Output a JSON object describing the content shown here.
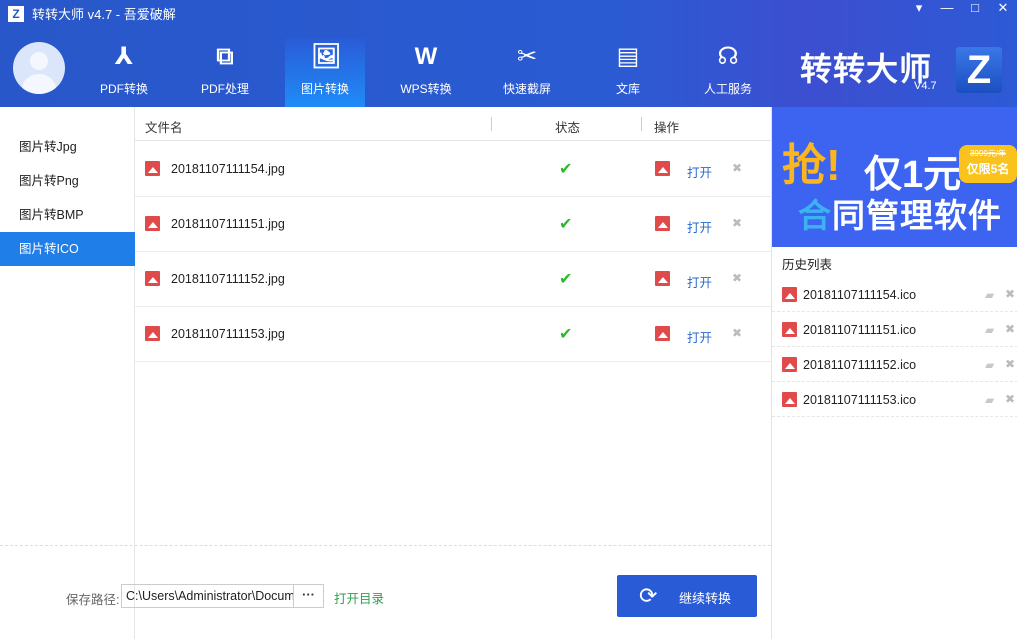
{
  "window": {
    "title": "转转大师 v4.7 - 吾爱破解",
    "app_icon": "Z",
    "controls": [
      "▾",
      "—",
      "□",
      "✕"
    ]
  },
  "nav": {
    "tabs": [
      {
        "label": "PDF转换",
        "icon": "pdf-icon",
        "glyph": "⅄"
      },
      {
        "label": "PDF处理",
        "icon": "squares-icon",
        "glyph": "⧉"
      },
      {
        "label": "图片转换",
        "icon": "image-icon",
        "glyph": "🖼"
      },
      {
        "label": "WPS转换",
        "icon": "wps-icon",
        "glyph": "W"
      },
      {
        "label": "快速截屏",
        "icon": "scissors-icon",
        "glyph": "✂"
      },
      {
        "label": "文库",
        "icon": "book-icon",
        "glyph": "▤"
      },
      {
        "label": "人工服务",
        "icon": "headset-icon",
        "glyph": "☊"
      }
    ],
    "active": 2
  },
  "brand": {
    "name": "转转大师",
    "version": "V4.7",
    "logo": "Z"
  },
  "sidebar": {
    "items": [
      "图片转Jpg",
      "图片转Png",
      "图片转BMP",
      "图片转ICO"
    ],
    "active": 3
  },
  "table": {
    "headers": {
      "name": "文件名",
      "status": "状态",
      "action": "操作"
    },
    "rows": [
      {
        "name": "20181107111154.jpg",
        "status": "✔",
        "open": "打开",
        "remove": "✖"
      },
      {
        "name": "20181107111151.jpg",
        "status": "✔",
        "open": "打开",
        "remove": "✖"
      },
      {
        "name": "20181107111152.jpg",
        "status": "✔",
        "open": "打开",
        "remove": "✖"
      },
      {
        "name": "20181107111153.jpg",
        "status": "✔",
        "open": "打开",
        "remove": "✖"
      }
    ]
  },
  "bottom": {
    "path_label": "保存路径:",
    "path_value": "C:\\Users\\Administrator\\Documents",
    "more": "···",
    "open_dir": "打开目录",
    "convert": "继续转换",
    "convert_icon": "⟳"
  },
  "banner": {
    "grab": "抢!",
    "price": "仅1元",
    "original": "3999元/年",
    "limit": "仅限5名",
    "product_first": "合",
    "product_rest": "同管理软件"
  },
  "history": {
    "title": "历史列表",
    "items": [
      "20181107111154.ico",
      "20181107111151.ico",
      "20181107111152.ico",
      "20181107111153.ico"
    ],
    "folder": "▰",
    "remove": "✖"
  },
  "colors": {
    "header": "#2a5bd7",
    "active_item": "#1f7ee8",
    "success": "#2db92d",
    "link": "#2a6acb"
  }
}
